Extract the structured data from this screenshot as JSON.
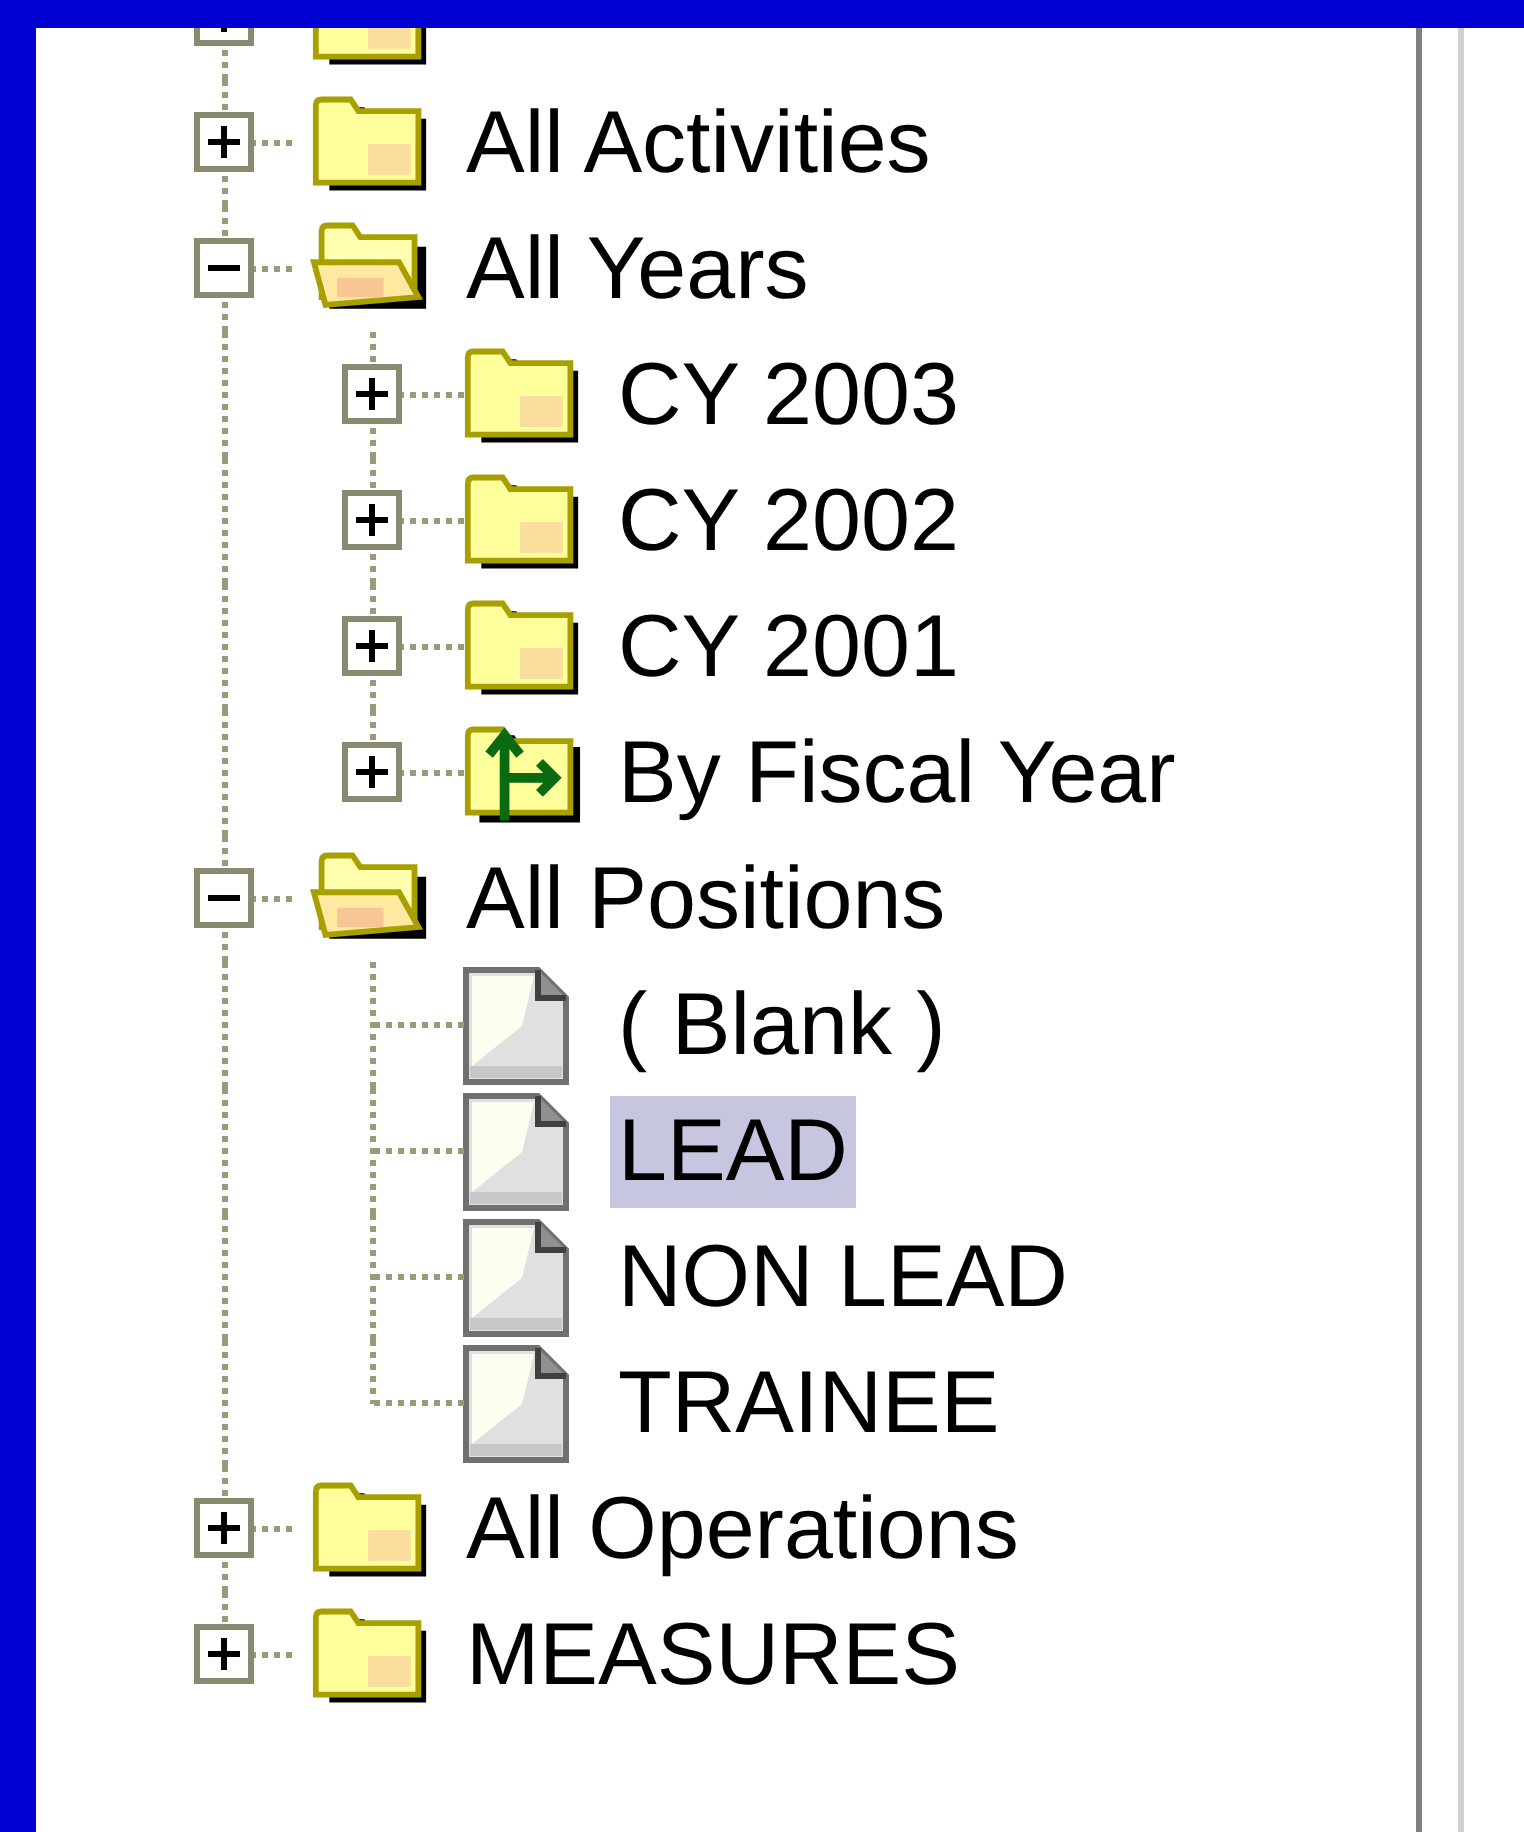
{
  "tree": [
    {
      "kind": "folder",
      "expanded": false
    },
    {
      "label": "All Activities",
      "kind": "folder",
      "expanded": false,
      "selected": false
    },
    {
      "label": "All Years",
      "kind": "folder",
      "expanded": true,
      "selected": false,
      "children": [
        {
          "label": "CY 2003",
          "kind": "folder",
          "expanded": false,
          "selected": false
        },
        {
          "label": "CY 2002",
          "kind": "folder",
          "expanded": false,
          "selected": false
        },
        {
          "label": "CY 2001",
          "kind": "folder",
          "expanded": false,
          "selected": false
        },
        {
          "label": "By Fiscal Year",
          "kind": "special-folder",
          "expanded": false,
          "selected": false
        }
      ]
    },
    {
      "label": "All Positions",
      "kind": "folder",
      "expanded": true,
      "selected": false,
      "children": [
        {
          "label": "( Blank )",
          "kind": "document",
          "selected": false
        },
        {
          "label": "LEAD",
          "kind": "document",
          "selected": true
        },
        {
          "label": "NON LEAD",
          "kind": "document",
          "selected": false
        },
        {
          "label": "TRAINEE",
          "kind": "document",
          "selected": false
        }
      ]
    },
    {
      "label": "All Operations",
      "kind": "folder",
      "expanded": false,
      "selected": false
    },
    {
      "label": "MEASURES",
      "kind": "folder",
      "expanded": false,
      "selected": false
    }
  ]
}
